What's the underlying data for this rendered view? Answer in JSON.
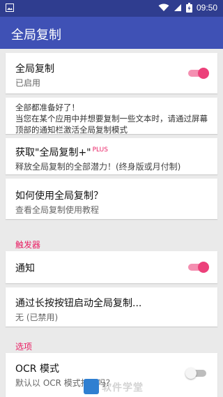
{
  "status_bar": {
    "time": "09:50",
    "icons": [
      "image-icon",
      "wifi-icon",
      "signal-icon",
      "battery-icon"
    ]
  },
  "app_bar": {
    "title": "全局复制"
  },
  "items": {
    "toggle_main": {
      "title": "全局复制",
      "subtitle": "已启用",
      "switch_on": true
    },
    "info_message": "全部都准备好了！\n当您在某个应用中并想要复制一些文本时，请通过屏幕顶部的通知栏激活全局复制模式",
    "plus": {
      "title": "获取\"全局复制+\"",
      "badge": "PLUS",
      "subtitle": "释放全局复制的全部潜力！(终身版或月付制)"
    },
    "howto": {
      "title": "如何使用全局复制？",
      "subtitle": "查看全局复制使用教程"
    }
  },
  "sections": {
    "trigger": {
      "label": "触发器",
      "notification": {
        "title": "通知",
        "switch_on": true
      },
      "long_press": {
        "title": "通过长按按钮启动全局复制...",
        "subtitle": "无 (已禁用)"
      }
    },
    "options": {
      "label": "选项",
      "ocr": {
        "title": "OCR 模式",
        "subtitle": "默认以 OCR 模式打开吗？",
        "switch_on": false
      }
    }
  },
  "watermark": {
    "text": "软件学堂"
  },
  "colors": {
    "status_bar": "#2f3d8f",
    "app_bar": "#3f51b5",
    "accent": "#e91e63"
  }
}
